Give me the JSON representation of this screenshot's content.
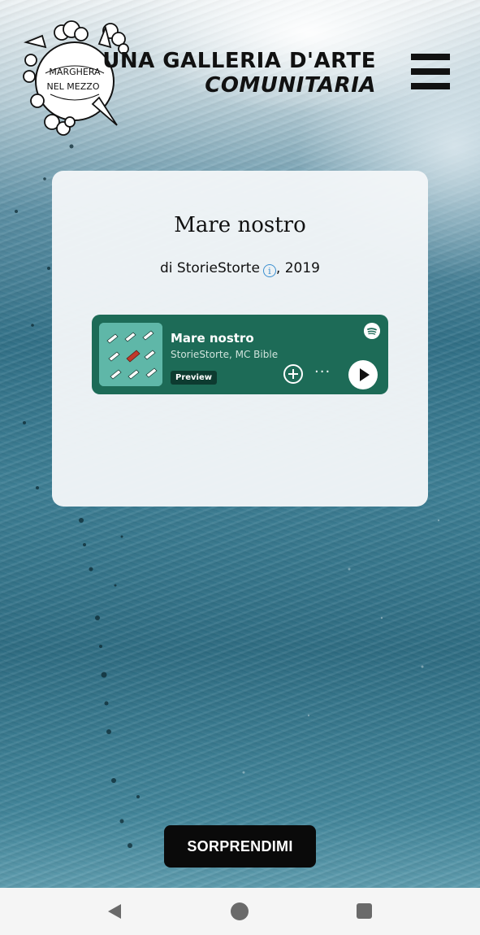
{
  "header": {
    "logo_text_line1": "MARGHERA",
    "logo_text_line2": "NEL MEZZO",
    "title_line1": "UNA GALLERIA D'ARTE",
    "title_line2": "COMUNITARIA",
    "menu_icon": "hamburger-menu-icon"
  },
  "card": {
    "title": "Mare nostro",
    "byline_prefix": "di ",
    "author": "StorieStorte",
    "byline_suffix": ", 2019",
    "info_icon": "info-icon"
  },
  "spotify_embed": {
    "track_title": "Mare nostro",
    "artists": "StorieStorte, MC Bible",
    "badge": "Preview",
    "more_label": "···",
    "background_color": "#1d6b57"
  },
  "actions": {
    "surprise_label": "SORPRENDIMI"
  },
  "navbar": {
    "back_icon": "back-triangle-icon",
    "home_icon": "home-circle-icon",
    "recents_icon": "recents-square-icon"
  }
}
